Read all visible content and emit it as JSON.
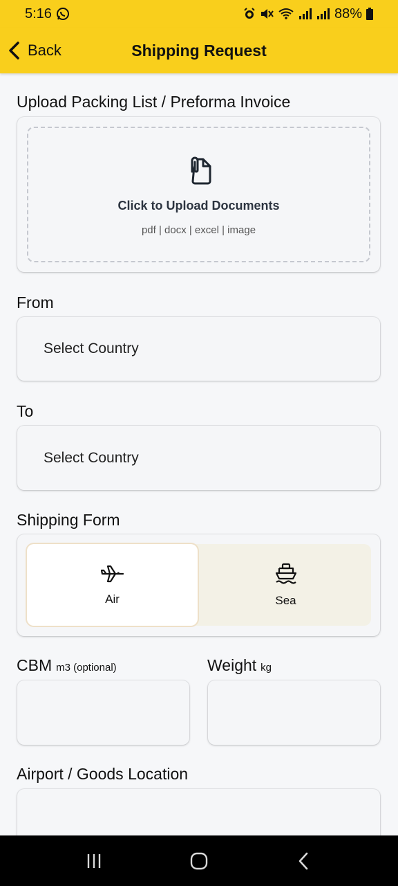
{
  "status": {
    "time": "5:16",
    "battery": "88%"
  },
  "header": {
    "back_label": "Back",
    "title": "Shipping Request"
  },
  "upload": {
    "label": "Upload Packing List / Preforma Invoice",
    "cta": "Click to Upload Documents",
    "formats": "pdf | docx | excel | image"
  },
  "from": {
    "label": "From",
    "placeholder": "Select Country"
  },
  "to": {
    "label": "To",
    "placeholder": "Select Country"
  },
  "shipping_form": {
    "label": "Shipping Form",
    "options": [
      {
        "label": "Air",
        "icon": "airplane-icon",
        "selected": true
      },
      {
        "label": "Sea",
        "icon": "ship-icon",
        "selected": false
      }
    ]
  },
  "cbm": {
    "label": "CBM",
    "unit": "m3 (optional)",
    "value": ""
  },
  "weight": {
    "label": "Weight",
    "unit": "kg",
    "value": ""
  },
  "location": {
    "label": "Airport / Goods Location",
    "value": ""
  },
  "colors": {
    "accent": "#f9cf1c",
    "background": "#f6f7f9",
    "toggle_background": "#f3f1e6"
  }
}
